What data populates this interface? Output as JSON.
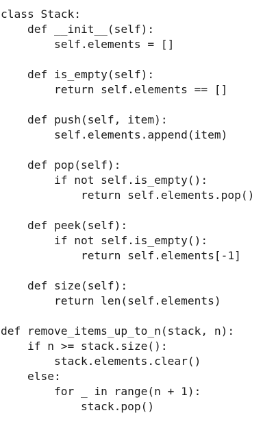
{
  "code": {
    "lines": [
      "class Stack:",
      "    def __init__(self):",
      "        self.elements = []",
      "",
      "    def is_empty(self):",
      "        return self.elements == []",
      "",
      "    def push(self, item):",
      "        self.elements.append(item)",
      "",
      "    def pop(self):",
      "        if not self.is_empty():",
      "            return self.elements.pop()",
      "",
      "    def peek(self):",
      "        if not self.is_empty():",
      "            return self.elements[-1]",
      "",
      "    def size(self):",
      "        return len(self.elements)",
      "",
      "def remove_items_up_to_n(stack, n):",
      "    if n >= stack.size():",
      "        stack.elements.clear()",
      "    else:",
      "        for _ in range(n + 1):",
      "            stack.pop()"
    ]
  }
}
